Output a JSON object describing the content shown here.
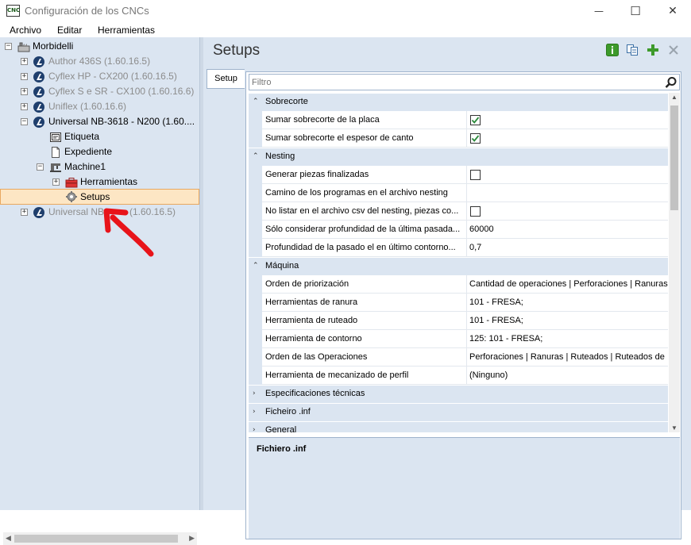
{
  "window": {
    "title": "Configuración de los CNCs",
    "app_icon_text": "CNC",
    "minimize": "—",
    "maximize": "☐",
    "close": "✕"
  },
  "menu": [
    "Archivo",
    "Editar",
    "Herramientas"
  ],
  "tree": {
    "root": "Morbidelli",
    "items": [
      {
        "label": "Author 436S (1.60.16.5)",
        "state": "disabled"
      },
      {
        "label": "Cyflex HP - CX200 (1.60.16.5)",
        "state": "disabled"
      },
      {
        "label": "Cyflex S e SR - CX100 (1.60.16.6)",
        "state": "disabled"
      },
      {
        "label": "Uniflex (1.60.16.6)",
        "state": "disabled"
      },
      {
        "label": "Universal NB-3618 - N200 (1.60....",
        "state": "expanded"
      },
      {
        "label": "Etiqueta"
      },
      {
        "label": "Expediente"
      },
      {
        "label": "Machine1"
      },
      {
        "label": "Herramientas"
      },
      {
        "label": "Setups",
        "state": "selected"
      },
      {
        "label": "Universal NB-",
        "label_tail": "(1.60.16.5)",
        "state": "disabled"
      }
    ]
  },
  "panel": {
    "title": "Setups",
    "tab": "Setup",
    "filter_placeholder": "Filtro",
    "description_title": "Fichiero .inf"
  },
  "grid": {
    "categories": [
      {
        "name": "Sobrecorte",
        "rows": [
          {
            "name": "Sumar sobrecorte de la placa",
            "value": "",
            "checked": true
          },
          {
            "name": "Sumar sobrecorte el espesor de canto",
            "value": "",
            "checked": true
          }
        ]
      },
      {
        "name": "Nesting",
        "rows": [
          {
            "name": "Generar piezas finalizadas",
            "value": "",
            "checked": false
          },
          {
            "name": "Camino de los programas en el archivo nesting",
            "value": ""
          },
          {
            "name": "No listar en el archivo csv del nesting, piezas co...",
            "value": "",
            "checked": false
          },
          {
            "name": "Sólo considerar profundidad de la última pasada...",
            "value": "60000"
          },
          {
            "name": "Profundidad de la pasado el en último contorno...",
            "value": "0,7"
          }
        ]
      },
      {
        "name": "Máquina",
        "rows": [
          {
            "name": "Orden de priorización",
            "value": "Cantidad de operaciones | Perforaciones | Ranuras"
          },
          {
            "name": "Herramientas de ranura",
            "value": "101 - FRESA;"
          },
          {
            "name": "Herramienta de ruteado",
            "value": "101 - FRESA;"
          },
          {
            "name": "Herramienta de contorno",
            "value": "125: 101 - FRESA;"
          },
          {
            "name": "Orden de las Operaciones",
            "value": "Perforaciones | Ranuras | Ruteados | Ruteados de"
          },
          {
            "name": "Herramienta de mecanizado de perfil",
            "value": "(Ninguno)"
          }
        ]
      },
      {
        "name": "Especificaciones técnicas",
        "collapsed": true,
        "rows": []
      },
      {
        "name": "Ficheiro .inf",
        "collapsed": true,
        "rows": []
      },
      {
        "name": "General",
        "collapsed": true,
        "rows": []
      }
    ]
  },
  "colors": {
    "panel_bg": "#dbe5f1",
    "selected_bg": "#fde6c4",
    "selected_border": "#e8a860",
    "arrow": "#e8141a",
    "green_btn": "#3d9a2b"
  }
}
